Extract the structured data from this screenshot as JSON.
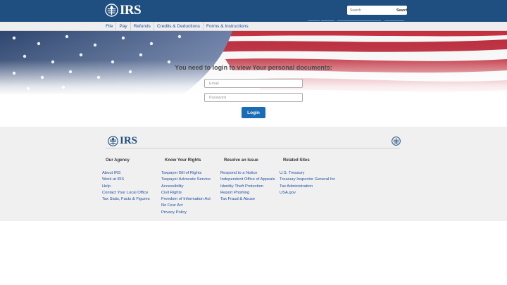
{
  "header": {
    "logo_text": "IRS",
    "search_placeholder": "Search",
    "search_button": "Search"
  },
  "nav": [
    {
      "label": "File"
    },
    {
      "label": "Pay"
    },
    {
      "label": "Refunds"
    },
    {
      "label": "Credits & Deductions"
    },
    {
      "label": "Forms & Instructions"
    }
  ],
  "login": {
    "title": "You need to login to view Your personal documents:",
    "email_placeholder": "Email",
    "password_placeholder": "Password",
    "button_label": "Login"
  },
  "footer": {
    "logo_text": "IRS",
    "columns": [
      {
        "heading": "Our Agency",
        "links": [
          "About IRS",
          "Work at IRS",
          "Help",
          "Contact Your Local Office",
          "Tax Stats, Facts & Figures"
        ]
      },
      {
        "heading": "Know Your Rights",
        "links": [
          "Taxpayer Bill of Rights",
          "Taxpayer Advocate Service",
          "Accessibility",
          "Civil Rights",
          "Freedom of Information Act",
          "No Fear Act",
          "Privacy Policy"
        ]
      },
      {
        "heading": "Resolve an Issue",
        "links": [
          "Respond to a Notice",
          "Independent Office of Appeals",
          "Identity Theft Protection",
          "Report Phishing",
          "Tax Fraud & Abuse"
        ]
      },
      {
        "heading": "Related Sites",
        "links": [
          "U.S. Treasury",
          "Treasury Inspector General for Tax Administration",
          "USA.gov"
        ]
      }
    ]
  },
  "colors": {
    "header_bg": "#1f4f80",
    "link": "#1f4f9f",
    "button": "#1a6cb4",
    "footer_bg": "#f0f0f0"
  },
  "icons": [
    "irs-eagle-logo",
    "irs-seal-icon",
    "search-icon"
  ]
}
